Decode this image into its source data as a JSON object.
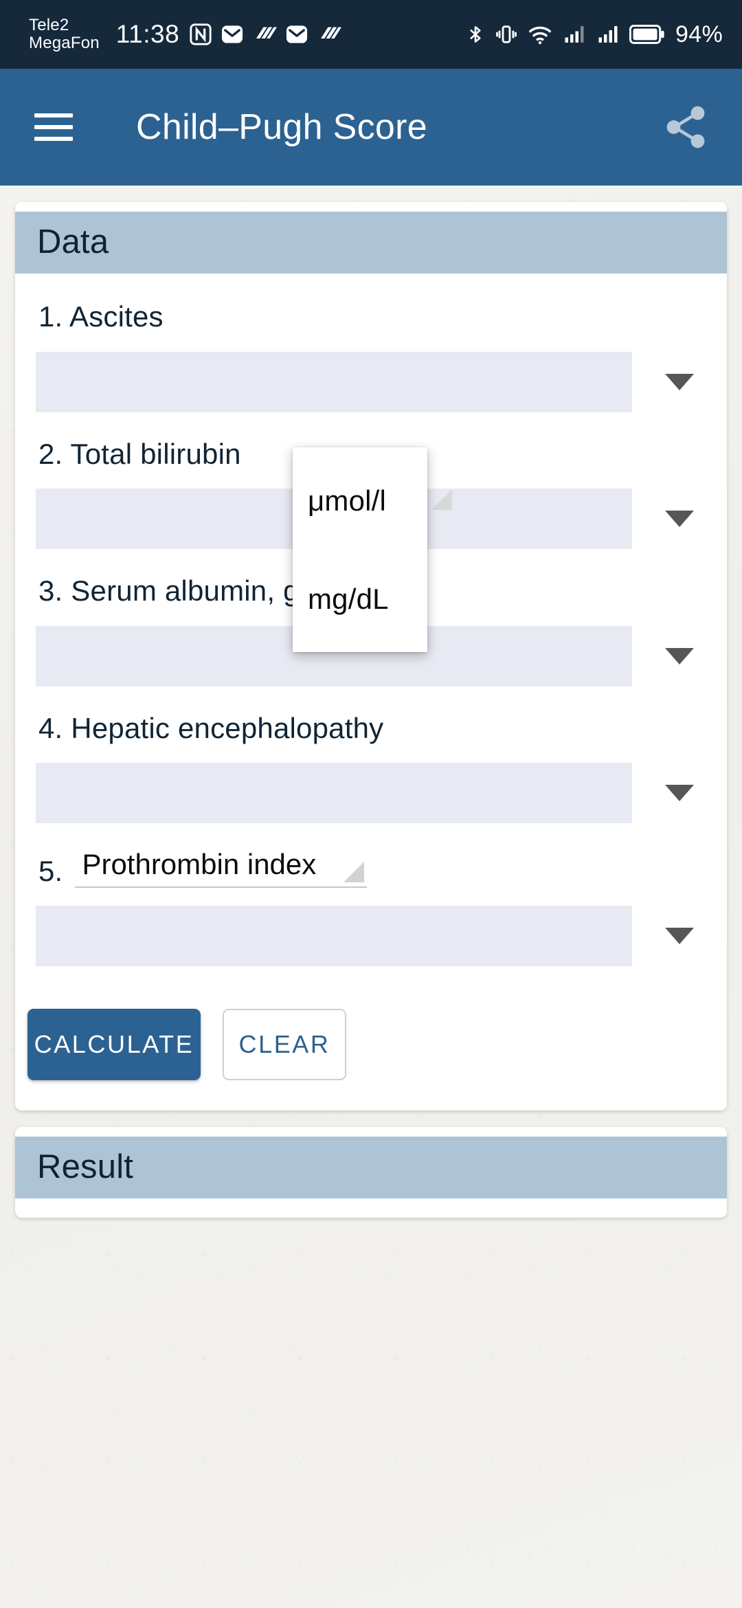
{
  "statusbar": {
    "carrier": "Tele2\nMegaFon",
    "time": "11:38",
    "left_icons": [
      "nfc-icon",
      "mail-icon",
      "data-speed-icon",
      "mail-icon",
      "data-speed-icon"
    ],
    "right_icons": [
      "bluetooth-icon",
      "vibrate-icon",
      "wifi-icon",
      "signal-sim1-icon",
      "signal-sim2-icon",
      "battery-icon"
    ],
    "battery_percent": "94%"
  },
  "appbar": {
    "menu_icon": "hamburger-menu-icon",
    "title": "Child–Pugh Score",
    "share_icon": "share-icon"
  },
  "data_card": {
    "header": "Data",
    "fields": [
      {
        "label": "1. Ascites",
        "value": "",
        "caret": "chevron-down-icon"
      },
      {
        "label": "2. Total bilirubin",
        "value": "",
        "caret": "chevron-down-icon"
      },
      {
        "label": "3. Serum albumin, g/L",
        "value": "",
        "caret": "chevron-down-icon"
      },
      {
        "label": "4. Hepatic encephalopathy",
        "value": "",
        "caret": "chevron-down-icon"
      }
    ],
    "field5": {
      "number": "5.",
      "spinner_value": "Prothrombin index",
      "value": "",
      "caret": "chevron-down-icon"
    },
    "buttons": {
      "calculate": "CALCULATE",
      "clear": "CLEAR"
    }
  },
  "result_card": {
    "header": "Result",
    "body": ""
  },
  "dropdown_popup": {
    "items": [
      {
        "label": "μmol/l"
      },
      {
        "label": "mg/dL"
      }
    ]
  },
  "colors": {
    "statusbar_bg": "#15293b",
    "appbar_bg": "#2c6291",
    "card_header_bg": "#aec4d5",
    "field_bg": "#e7e9f3",
    "primary_button": "#2c6291",
    "page_bg": "#f2f1ee",
    "label_text": "#112434"
  }
}
